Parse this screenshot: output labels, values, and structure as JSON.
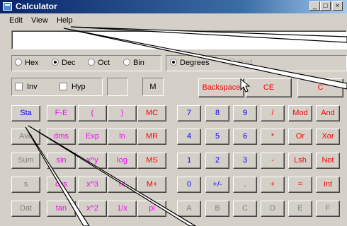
{
  "window": {
    "title": "Calculator",
    "minimize": "_",
    "maximize": "□",
    "close": "×"
  },
  "menu": [
    "Edit",
    "View",
    "Help"
  ],
  "display": {
    "value": ""
  },
  "base_radios": [
    {
      "label": "Hex",
      "selected": false
    },
    {
      "label": "Dec",
      "selected": true
    },
    {
      "label": "Oct",
      "selected": false
    },
    {
      "label": "Bin",
      "selected": false
    }
  ],
  "angle_radios": [
    {
      "label": "Degrees",
      "selected": true
    },
    {
      "label": "Rad",
      "selected": false
    }
  ],
  "checks": [
    {
      "label": "Inv"
    },
    {
      "label": "Hyp"
    }
  ],
  "memory_indicator": "M",
  "edit_buttons": [
    "Backspace",
    "CE",
    "C"
  ],
  "keys": {
    "sci_row1": [
      "Sta",
      "F-E",
      "(",
      ")"
    ],
    "sci_row2": [
      "Ave",
      "dms",
      "Exp",
      "ln"
    ],
    "sci_row3": [
      "Sum",
      "sin",
      "x^y",
      "log"
    ],
    "sci_row4": [
      "s",
      "cos",
      "x^3",
      "n!"
    ],
    "sci_row5": [
      "Dat",
      "tan",
      "x^2",
      "1/x"
    ],
    "memory": [
      "MC",
      "MR",
      "MS",
      "M+",
      "pi"
    ],
    "num_row1": [
      "7",
      "8",
      "9",
      "/",
      "Mod",
      "And"
    ],
    "num_row2": [
      "4",
      "5",
      "6",
      "*",
      "Or",
      "Xor"
    ],
    "num_row3": [
      "1",
      "2",
      "3",
      "-",
      "Lsh",
      "Not"
    ],
    "num_row4": [
      "0",
      "+/-",
      ".",
      "+",
      "=",
      "Int"
    ],
    "num_row5": [
      "A",
      "B",
      "C",
      "D",
      "E",
      "F"
    ]
  }
}
